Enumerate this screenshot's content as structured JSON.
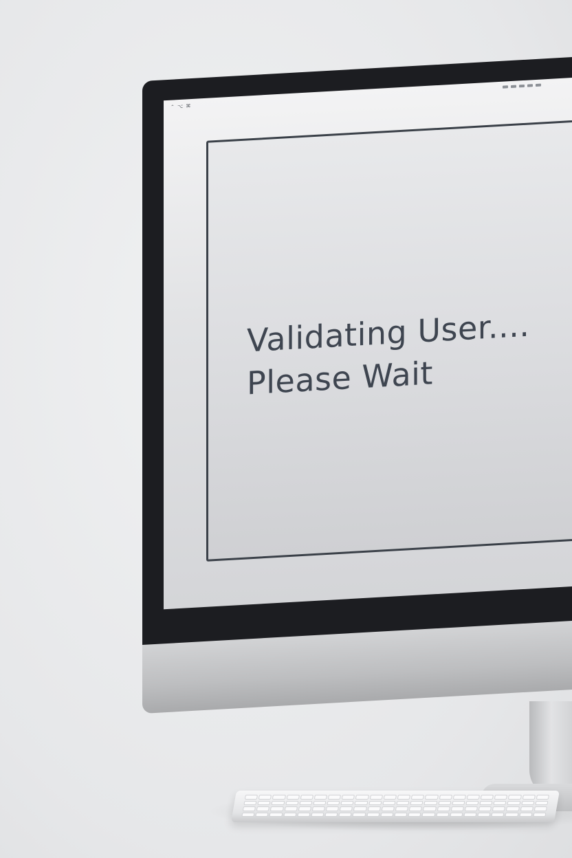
{
  "screen": {
    "menubar_left_text": "⌃ ⌥ ⌘",
    "dialog": {
      "message_line1": "Validating User....",
      "message_line2": "Please Wait"
    }
  },
  "colors": {
    "background": "#e9eaec",
    "bezel": "#1c1d21",
    "screen": "#e1e2e4",
    "dialog_border": "#3a4048",
    "message_text": "#3e4550"
  }
}
